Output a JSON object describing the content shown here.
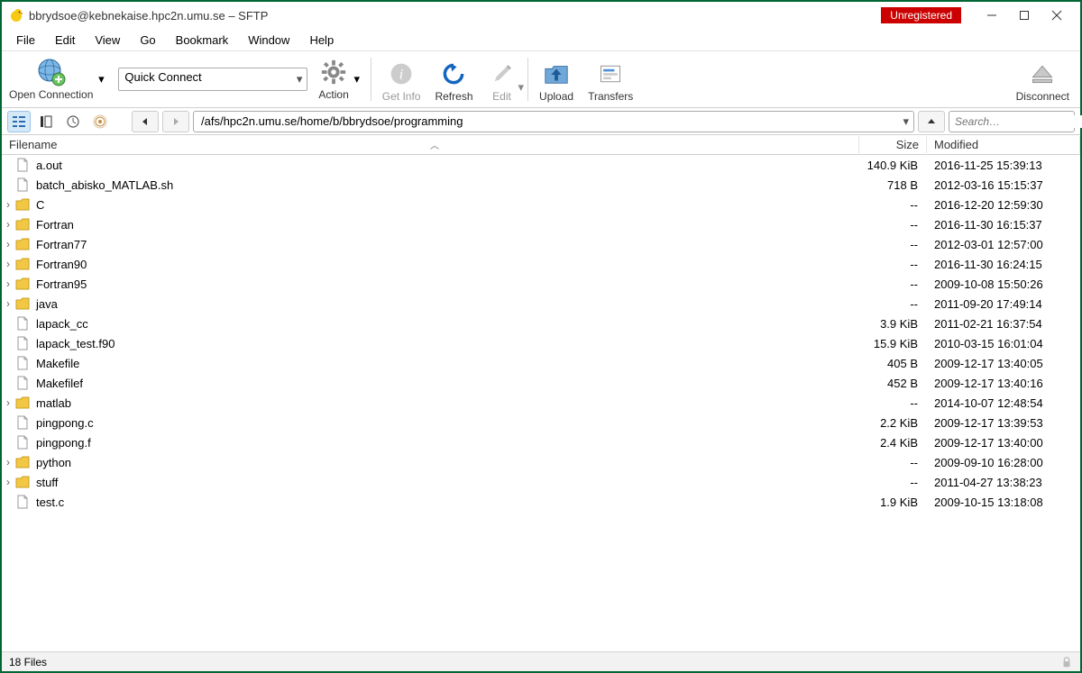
{
  "title": "bbrydsoe@kebnekaise.hpc2n.umu.se – SFTP",
  "badge": "Unregistered",
  "menus": [
    "File",
    "Edit",
    "View",
    "Go",
    "Bookmark",
    "Window",
    "Help"
  ],
  "toolbar": {
    "open_connection": "Open Connection",
    "quick_connect": "Quick Connect",
    "action": "Action",
    "get_info": "Get Info",
    "refresh": "Refresh",
    "edit": "Edit",
    "upload": "Upload",
    "transfers": "Transfers",
    "disconnect": "Disconnect"
  },
  "path": "/afs/hpc2n.umu.se/home/b/bbrydsoe/programming",
  "search_placeholder": "Search…",
  "columns": {
    "filename": "Filename",
    "size": "Size",
    "modified": "Modified"
  },
  "files": [
    {
      "t": "file",
      "exp": "",
      "name": "a.out",
      "size": "140.9 KiB",
      "mod": "2016-11-25 15:39:13"
    },
    {
      "t": "file",
      "exp": "",
      "name": "batch_abisko_MATLAB.sh",
      "size": "718 B",
      "mod": "2012-03-16 15:15:37"
    },
    {
      "t": "folder",
      "exp": "›",
      "name": "C",
      "size": "--",
      "mod": "2016-12-20 12:59:30"
    },
    {
      "t": "folder",
      "exp": "›",
      "name": "Fortran",
      "size": "--",
      "mod": "2016-11-30 16:15:37"
    },
    {
      "t": "folder",
      "exp": "›",
      "name": "Fortran77",
      "size": "--",
      "mod": "2012-03-01 12:57:00"
    },
    {
      "t": "folder",
      "exp": "›",
      "name": "Fortran90",
      "size": "--",
      "mod": "2016-11-30 16:24:15"
    },
    {
      "t": "folder",
      "exp": "›",
      "name": "Fortran95",
      "size": "--",
      "mod": "2009-10-08 15:50:26"
    },
    {
      "t": "folder",
      "exp": "›",
      "name": "java",
      "size": "--",
      "mod": "2011-09-20 17:49:14"
    },
    {
      "t": "file",
      "exp": "",
      "name": "lapack_cc",
      "size": "3.9 KiB",
      "mod": "2011-02-21 16:37:54"
    },
    {
      "t": "file",
      "exp": "",
      "name": "lapack_test.f90",
      "size": "15.9 KiB",
      "mod": "2010-03-15 16:01:04"
    },
    {
      "t": "file",
      "exp": "",
      "name": "Makefile",
      "size": "405 B",
      "mod": "2009-12-17 13:40:05"
    },
    {
      "t": "file",
      "exp": "",
      "name": "Makefilef",
      "size": "452 B",
      "mod": "2009-12-17 13:40:16"
    },
    {
      "t": "folder",
      "exp": "›",
      "name": "matlab",
      "size": "--",
      "mod": "2014-10-07 12:48:54"
    },
    {
      "t": "file",
      "exp": "",
      "name": "pingpong.c",
      "size": "2.2 KiB",
      "mod": "2009-12-17 13:39:53"
    },
    {
      "t": "file",
      "exp": "",
      "name": "pingpong.f",
      "size": "2.4 KiB",
      "mod": "2009-12-17 13:40:00"
    },
    {
      "t": "folder",
      "exp": "›",
      "name": "python",
      "size": "--",
      "mod": "2009-09-10 16:28:00"
    },
    {
      "t": "folder",
      "exp": "›",
      "name": "stuff",
      "size": "--",
      "mod": "2011-04-27 13:38:23"
    },
    {
      "t": "file",
      "exp": "",
      "name": "test.c",
      "size": "1.9 KiB",
      "mod": "2009-10-15 13:18:08"
    }
  ],
  "status": "18 Files"
}
